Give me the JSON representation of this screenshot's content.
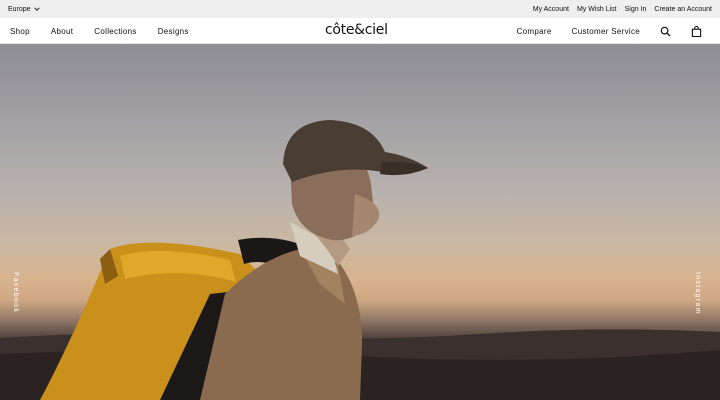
{
  "utility_bar": {
    "region": "Europe",
    "links": [
      "My Account",
      "My Wish List",
      "Sign In",
      "Create an Account"
    ]
  },
  "nav": {
    "left": [
      "Shop",
      "About",
      "Collections",
      "Designs"
    ],
    "logo": "côte&ciel",
    "right": [
      "Compare",
      "Customer Service"
    ],
    "icons": [
      "search-icon",
      "shopping-bag-icon"
    ]
  },
  "social": {
    "left": "Facebook",
    "right": "Instagram"
  },
  "colors": {
    "utility_bg": "#efefef",
    "text": "#111111",
    "hero_text": "#ffffff"
  }
}
